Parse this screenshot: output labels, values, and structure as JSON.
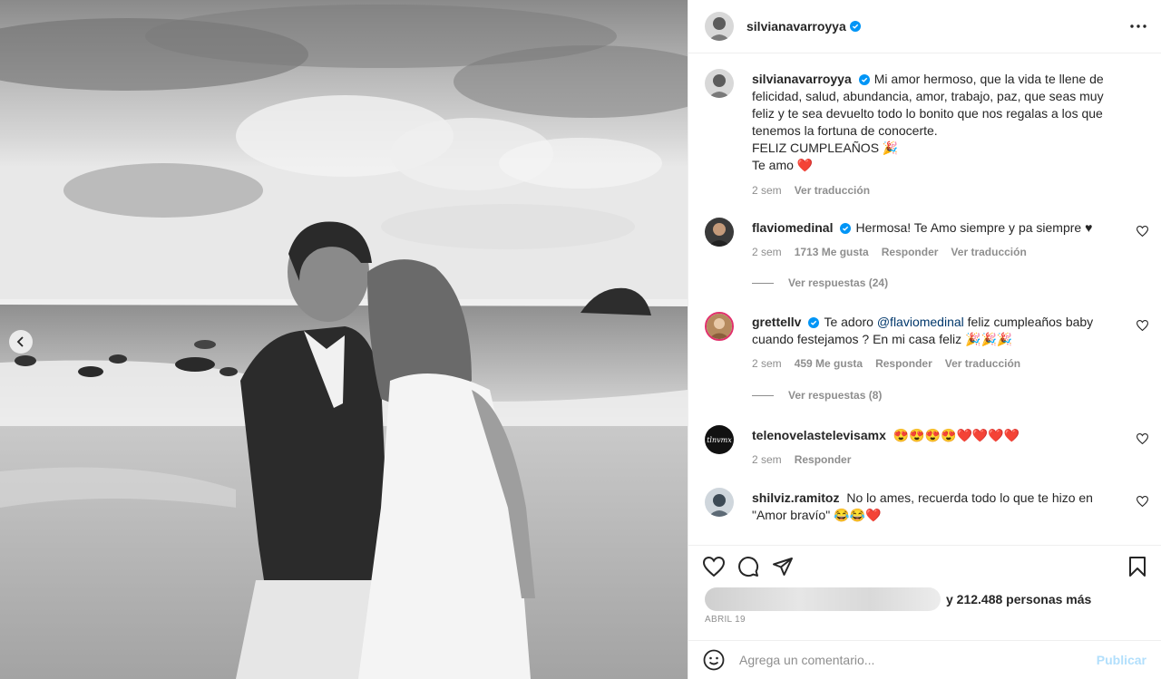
{
  "post": {
    "username": "silvianavarroyya",
    "caption_lines": [
      "Mi amor hermoso, que la vida te llene de",
      "felicidad, salud, abundancia, amor, trabajo, paz, que seas muy",
      "feliz y te sea devuelto todo lo bonito que nos regalas a los que",
      "tenemos la fortuna de conocerte.",
      "FELIZ CUMPLEAÑOS 🎉",
      "Te amo ❤️"
    ],
    "caption_time": "2 sem",
    "caption_translate": "Ver traducción",
    "likes_text": "y 212.488 personas más",
    "date": "ABRIL 19"
  },
  "comments": [
    {
      "username": "flaviomedinal",
      "verified": true,
      "text": "Hermosa! Te Amo siempre y pa siempre ♥",
      "time": "2 sem",
      "likes": "1713 Me gusta",
      "reply": "Responder",
      "translate": "Ver traducción",
      "view_replies": "Ver respuestas (24)"
    },
    {
      "username": "grettellv",
      "verified": true,
      "mention": "@flaviomedinal",
      "text_before": "Te adoro",
      "text_after_1": "feliz cumpleaños baby",
      "text_after_2": "cuando festejamos ? En mi casa feliz 🎉🎉🎉",
      "time": "2 sem",
      "likes": "459 Me gusta",
      "reply": "Responder",
      "translate": "Ver traducción",
      "view_replies": "Ver respuestas (8)"
    },
    {
      "username": "telenovelastelevisamx",
      "avatar_text": "tlnvmx",
      "text": "😍😍😍😍❤️❤️❤️❤️",
      "time": "2 sem",
      "reply": "Responder"
    },
    {
      "username": "shilviz.ramitoz",
      "text_line1": "No lo ames, recuerda todo lo que te hizo en",
      "text_line2": "\"Amor bravío\" 😂😂❤️"
    }
  ],
  "add_comment": {
    "placeholder": "Agrega un comentario...",
    "publish": "Publicar"
  },
  "colors": {
    "verified": "#0095f6",
    "muted": "#8e8e8e",
    "link": "#00376b",
    "publish_disabled": "#b2dffc"
  },
  "icons": [
    "more-icon",
    "heart-icon",
    "comment-icon",
    "share-icon",
    "save-icon",
    "emoji-icon",
    "verified-icon",
    "chevron-left-icon"
  ]
}
